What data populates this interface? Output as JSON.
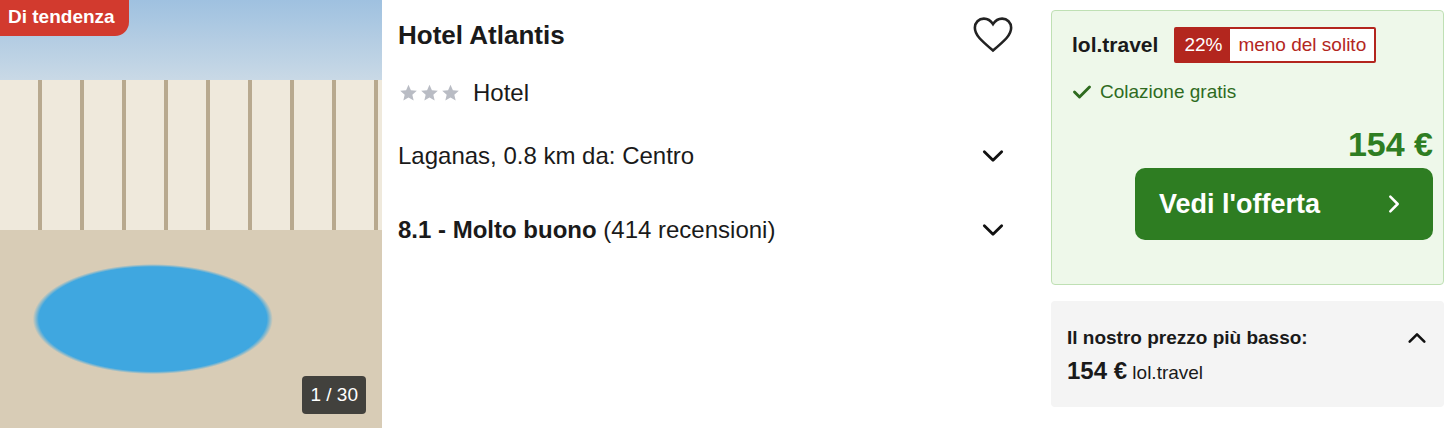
{
  "badge": "Di tendenza",
  "photo": {
    "counter": "1 / 30"
  },
  "hotel": {
    "name": "Hotel Atlantis",
    "favorite": false,
    "stars": 3,
    "type": "Hotel",
    "location": "Laganas, 0.8 km da: Centro",
    "location_expanded": false,
    "rating": "8.1 - Molto buono",
    "reviews": "(414 recensioni)",
    "rating_expanded": false
  },
  "offer": {
    "provider": "lol.travel",
    "discount": "22%",
    "discount_label": "meno del solito",
    "perk": "Colazione gratis",
    "price": "154 €",
    "button": "Vedi l'offerta"
  },
  "lowest": {
    "label": "Il nostro prezzo più basso:",
    "price": "154 €",
    "provider": "lol.travel",
    "expanded": true
  }
}
